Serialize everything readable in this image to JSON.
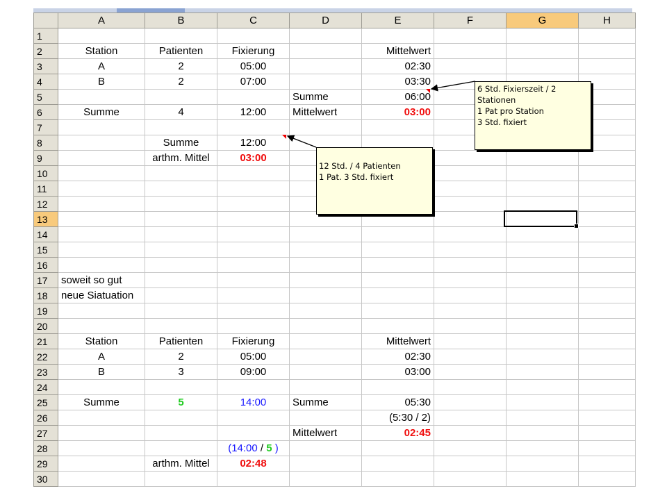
{
  "columns": [
    "A",
    "B",
    "C",
    "D",
    "E",
    "F",
    "G",
    "H"
  ],
  "selected_column": "G",
  "selected_row": "13",
  "rows": [
    {
      "n": "1",
      "cells": [
        "",
        "",
        "",
        "",
        "",
        "",
        "",
        ""
      ]
    },
    {
      "n": "2",
      "cells": [
        "Station",
        "Patienten",
        "Fixierung",
        "",
        "Mittelwert",
        "",
        "",
        ""
      ]
    },
    {
      "n": "3",
      "cells": [
        "A",
        "2",
        "05:00",
        "",
        "02:30",
        "",
        "",
        ""
      ]
    },
    {
      "n": "4",
      "cells": [
        "B",
        "2",
        "07:00",
        "",
        "03:30",
        "",
        "",
        ""
      ]
    },
    {
      "n": "5",
      "cells": [
        "",
        "",
        "",
        "Summe",
        "06:00",
        "",
        "",
        ""
      ]
    },
    {
      "n": "6",
      "cells": [
        "Summe",
        "4",
        "12:00",
        "Mittelwert",
        "03:00",
        "",
        "",
        ""
      ]
    },
    {
      "n": "7",
      "cells": [
        "",
        "",
        "",
        "",
        "",
        "",
        "",
        ""
      ]
    },
    {
      "n": "8",
      "cells": [
        "",
        "Summe",
        "12:00",
        "",
        "",
        "",
        "",
        ""
      ]
    },
    {
      "n": "9",
      "cells": [
        "",
        "arthm. Mittel",
        "03:00",
        "",
        "",
        "",
        "",
        ""
      ]
    },
    {
      "n": "10",
      "cells": [
        "",
        "",
        "",
        "",
        "",
        "",
        "",
        ""
      ]
    },
    {
      "n": "11",
      "cells": [
        "",
        "",
        "",
        "",
        "",
        "",
        "",
        ""
      ]
    },
    {
      "n": "12",
      "cells": [
        "",
        "",
        "",
        "",
        "",
        "",
        "",
        ""
      ]
    },
    {
      "n": "13",
      "cells": [
        "",
        "",
        "",
        "",
        "",
        "",
        "",
        ""
      ]
    },
    {
      "n": "14",
      "cells": [
        "",
        "",
        "",
        "",
        "",
        "",
        "",
        ""
      ]
    },
    {
      "n": "15",
      "cells": [
        "",
        "",
        "",
        "",
        "",
        "",
        "",
        ""
      ]
    },
    {
      "n": "16",
      "cells": [
        "",
        "",
        "",
        "",
        "",
        "",
        "",
        ""
      ]
    },
    {
      "n": "17",
      "cells": [
        "soweit so gut",
        "",
        "",
        "",
        "",
        "",
        "",
        ""
      ]
    },
    {
      "n": "18",
      "cells": [
        "neue Siatuation",
        "",
        "",
        "",
        "",
        "",
        "",
        ""
      ]
    },
    {
      "n": "19",
      "cells": [
        "",
        "",
        "",
        "",
        "",
        "",
        "",
        ""
      ]
    },
    {
      "n": "20",
      "cells": [
        "",
        "",
        "",
        "",
        "",
        "",
        "",
        ""
      ]
    },
    {
      "n": "21",
      "cells": [
        "Station",
        "Patienten",
        "Fixierung",
        "",
        "Mittelwert",
        "",
        "",
        ""
      ]
    },
    {
      "n": "22",
      "cells": [
        "A",
        "2",
        "05:00",
        "",
        "02:30",
        "",
        "",
        ""
      ]
    },
    {
      "n": "23",
      "cells": [
        "B",
        "3",
        "09:00",
        "",
        "03:00",
        "",
        "",
        ""
      ]
    },
    {
      "n": "24",
      "cells": [
        "",
        "",
        "",
        "",
        "",
        "",
        "",
        ""
      ]
    },
    {
      "n": "25",
      "cells": [
        "Summe",
        "5",
        "14:00",
        "Summe",
        "05:30",
        "",
        "",
        ""
      ]
    },
    {
      "n": "26",
      "cells": [
        "",
        "",
        "",
        "",
        "(5:30 / 2)",
        "",
        "",
        ""
      ]
    },
    {
      "n": "27",
      "cells": [
        "",
        "",
        "",
        "Mittelwert",
        "02:45",
        "",
        "",
        ""
      ]
    },
    {
      "n": "28",
      "cells": [
        "",
        "",
        "",
        "",
        "",
        "",
        "",
        ""
      ]
    },
    {
      "n": "29",
      "cells": [
        "",
        "arthm. Mittel",
        "02:48",
        "",
        "",
        "",
        "",
        ""
      ]
    },
    {
      "n": "30",
      "cells": [
        "",
        "",
        "",
        "",
        "",
        "",
        "",
        ""
      ]
    }
  ],
  "r28_formula": {
    "open": "(",
    "time": "14:00",
    "slash": " / ",
    "count": "5",
    "close": " )"
  },
  "comment1": {
    "lines": [
      "6 Std. Fixierszeit / 2",
      "Stationen",
      "1 Pat pro Station",
      "3 Std. fixiert"
    ]
  },
  "comment2": {
    "lines": [
      "12 Std. / 4 Patienten",
      "1 Pat. 3 Std. fixiert"
    ]
  },
  "colors": {
    "header_bg": "#e4e1d6",
    "selected_header": "#f8ca7c",
    "note_bg": "#ffffe1",
    "highlight_red": "#f00f0f",
    "green": "#22cc22",
    "blue": "#1a1aff"
  }
}
